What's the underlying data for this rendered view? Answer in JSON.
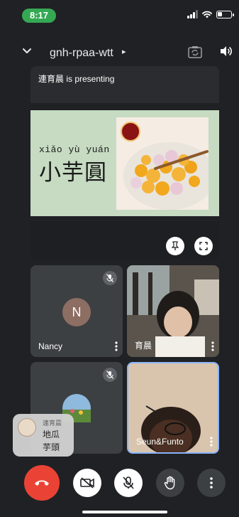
{
  "status": {
    "time": "8:17"
  },
  "header": {
    "meeting_code": "gnh-rpaa-wtt",
    "title_arrow": "▸"
  },
  "presentation": {
    "banner": "連育晨 is presenting",
    "slide_pinyin": "xiǎo yù yuán",
    "slide_hanzi": "小芋圓"
  },
  "participants": [
    {
      "name": "Nancy",
      "initial": "N",
      "muted": true
    },
    {
      "name": "育晨",
      "muted": false
    },
    {
      "name": "",
      "muted": true
    },
    {
      "name": "Seun&Funto",
      "muted": false
    }
  ],
  "sticker": {
    "sender": "連育晨",
    "line1": "地瓜",
    "line2": "芋頭"
  },
  "colors": {
    "background": "#202124",
    "end_call": "#ea4335",
    "active_border": "#8ab4f8",
    "time_pill": "#34a853"
  }
}
